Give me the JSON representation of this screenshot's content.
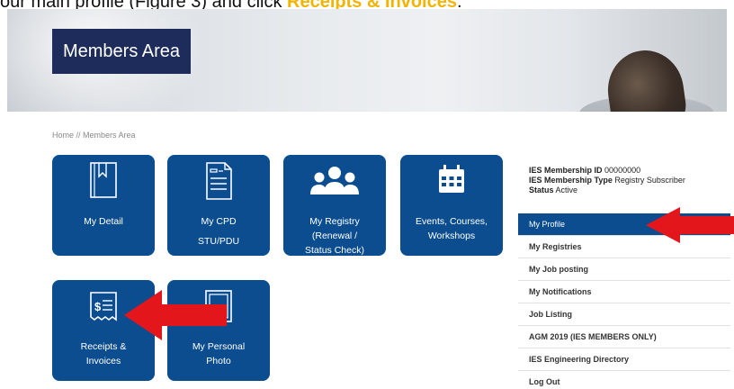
{
  "instruction": {
    "prefix": "our main profile (Figure 3) and click ",
    "highlight": "Receipts & Invoices",
    "suffix": "."
  },
  "banner": {
    "title": "Members Area"
  },
  "breadcrumb": "Home // Members Area",
  "tiles": [
    {
      "icon": "bookmark-book-icon",
      "lines": [
        "My Detail"
      ]
    },
    {
      "icon": "document-icon",
      "lines": [
        "My CPD",
        "STU/PDU"
      ]
    },
    {
      "icon": "group-people-icon",
      "lines": [
        "My Registry",
        "(Renewal /",
        "Status Check)"
      ]
    },
    {
      "icon": "calendar-icon",
      "lines": [
        "Events, Courses,",
        "Workshops"
      ]
    },
    {
      "icon": "receipt-icon",
      "lines": [
        "Receipts &",
        "Invoices"
      ]
    },
    {
      "icon": "photo-frame-icon",
      "lines": [
        "My Personal",
        "Photo"
      ]
    }
  ],
  "membership": {
    "id_label": "IES Membership ID",
    "id_value": "00000000",
    "type_label": "IES Membership Type",
    "type_value": "Registry Subscriber",
    "status_label": "Status",
    "status_value": "Active"
  },
  "menu": [
    "My Profile",
    "My Registries",
    "My Job posting",
    "My Notifications",
    "Job Listing",
    "AGM 2019 (IES MEMBERS ONLY)",
    "IES Engineering Directory",
    "Log Out"
  ],
  "colors": {
    "tile_blue": "#0b4d8f",
    "banner_title_bg": "#1d2c5a",
    "highlight": "#f2b400",
    "arrow_red": "#e3161b"
  }
}
